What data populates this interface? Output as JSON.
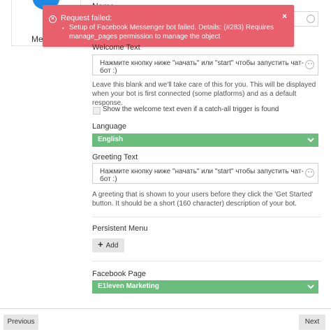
{
  "left_card": {
    "label": "Mes"
  },
  "top": {
    "name_label": "Name"
  },
  "toast": {
    "title": "Request failed:",
    "bullet": "•",
    "message": "Setup of Facebook Messenger bot failed. Details: (#283) Requires manage_pages permission to manage the object",
    "close": "×",
    "color": "#e8606c"
  },
  "welcome": {
    "label": "Welcome Text",
    "value": "Нажмите кнопку ниже \"начать\" или \"start\" чтобы запустить чат-бот :)",
    "help": "Leave this blank and we'll take care of this for you. This will be displayed when your bot is first connected (some platforms) and as a default response.",
    "checkbox_label": "Show the welcome text even if a catch-all trigger is found"
  },
  "language": {
    "label": "Language",
    "selected": "English",
    "color": "#6bbd7e"
  },
  "greeting": {
    "label": "Greeting Text",
    "value": "Нажмите кнопку ниже \"начать\" или \"start\" чтобы запустить чат-бот :)",
    "help": "A greeting that is shown to your users before they click the 'Get Started' button. It should be a short (160 character) description of your bot."
  },
  "menu": {
    "label": "Persistent Menu",
    "add_label": "Add"
  },
  "facebook_page": {
    "label": "Facebook Page",
    "selected": "E1leven Marketing"
  },
  "footer": {
    "previous": "Previous",
    "next": "Next"
  }
}
